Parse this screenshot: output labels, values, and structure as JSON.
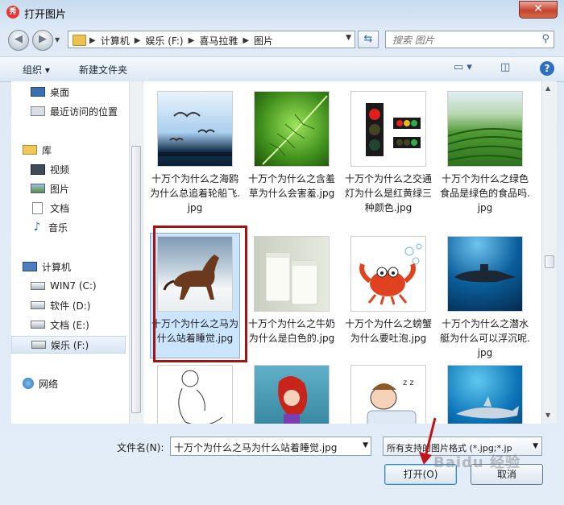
{
  "window": {
    "title": "打开图片",
    "close_label": "✕"
  },
  "address": {
    "crumbs": [
      "计算机",
      "娱乐 (F:)",
      "喜马拉雅",
      "图片"
    ]
  },
  "search": {
    "placeholder": "搜索 图片"
  },
  "toolbar": {
    "organize": "组织 ▾",
    "new_folder": "新建文件夹"
  },
  "nav": {
    "items": [
      {
        "label": "桌面",
        "icon": "desktop-icon"
      },
      {
        "label": "最近访问的位置",
        "icon": "recent-icon"
      },
      {
        "label": "库",
        "icon": "library-icon"
      },
      {
        "label": "视频",
        "icon": "video-icon"
      },
      {
        "label": "图片",
        "icon": "picture-icon"
      },
      {
        "label": "文档",
        "icon": "document-icon"
      },
      {
        "label": "音乐",
        "icon": "music-icon"
      },
      {
        "label": "计算机",
        "icon": "computer-icon"
      },
      {
        "label": "WIN7 (C:)",
        "icon": "drive-icon"
      },
      {
        "label": "软件 (D:)",
        "icon": "drive-icon"
      },
      {
        "label": "文档 (E:)",
        "icon": "drive-icon"
      },
      {
        "label": "娱乐 (F:)",
        "icon": "drive-icon"
      },
      {
        "label": "网络",
        "icon": "network-icon"
      }
    ]
  },
  "files": [
    {
      "name": "十万个为什么之海鸥为什么总追着轮船飞.jpg",
      "thumb": "seagulls"
    },
    {
      "name": "十万个为什么之含羞草为什么会害羞.jpg",
      "thumb": "fern"
    },
    {
      "name": "十万个为什么之交通灯为什么是红黄绿三种颜色.jpg",
      "thumb": "traffic-light"
    },
    {
      "name": "十万个为什么之绿色食品是绿色的食品吗.jpg",
      "thumb": "tea-field"
    },
    {
      "name": "十万个为什么之马为什么站着睡觉.jpg",
      "thumb": "horse"
    },
    {
      "name": "十万个为什么之牛奶为什么是白色的.jpg",
      "thumb": "milk"
    },
    {
      "name": "十万个为什么之螃蟹为什么要吐泡.jpg",
      "thumb": "crab"
    },
    {
      "name": "十万个为什么之潜水艇为什么可以浮沉呢.jpg",
      "thumb": "submarine"
    },
    {
      "name": "",
      "thumb": "sketch"
    },
    {
      "name": "",
      "thumb": "mermaid"
    },
    {
      "name": "",
      "thumb": "sleeping-kid"
    },
    {
      "name": "",
      "thumb": "shark"
    }
  ],
  "bottom": {
    "filename_label": "文件名(N):",
    "filename_value": "十万个为什么之马为什么站着睡觉.jpg",
    "filetype_value": "所有支持的图片格式 (*.jpg;*.jp",
    "open_label": "打开(O)",
    "cancel_label": "取消"
  },
  "watermark": "Baidu 经验"
}
